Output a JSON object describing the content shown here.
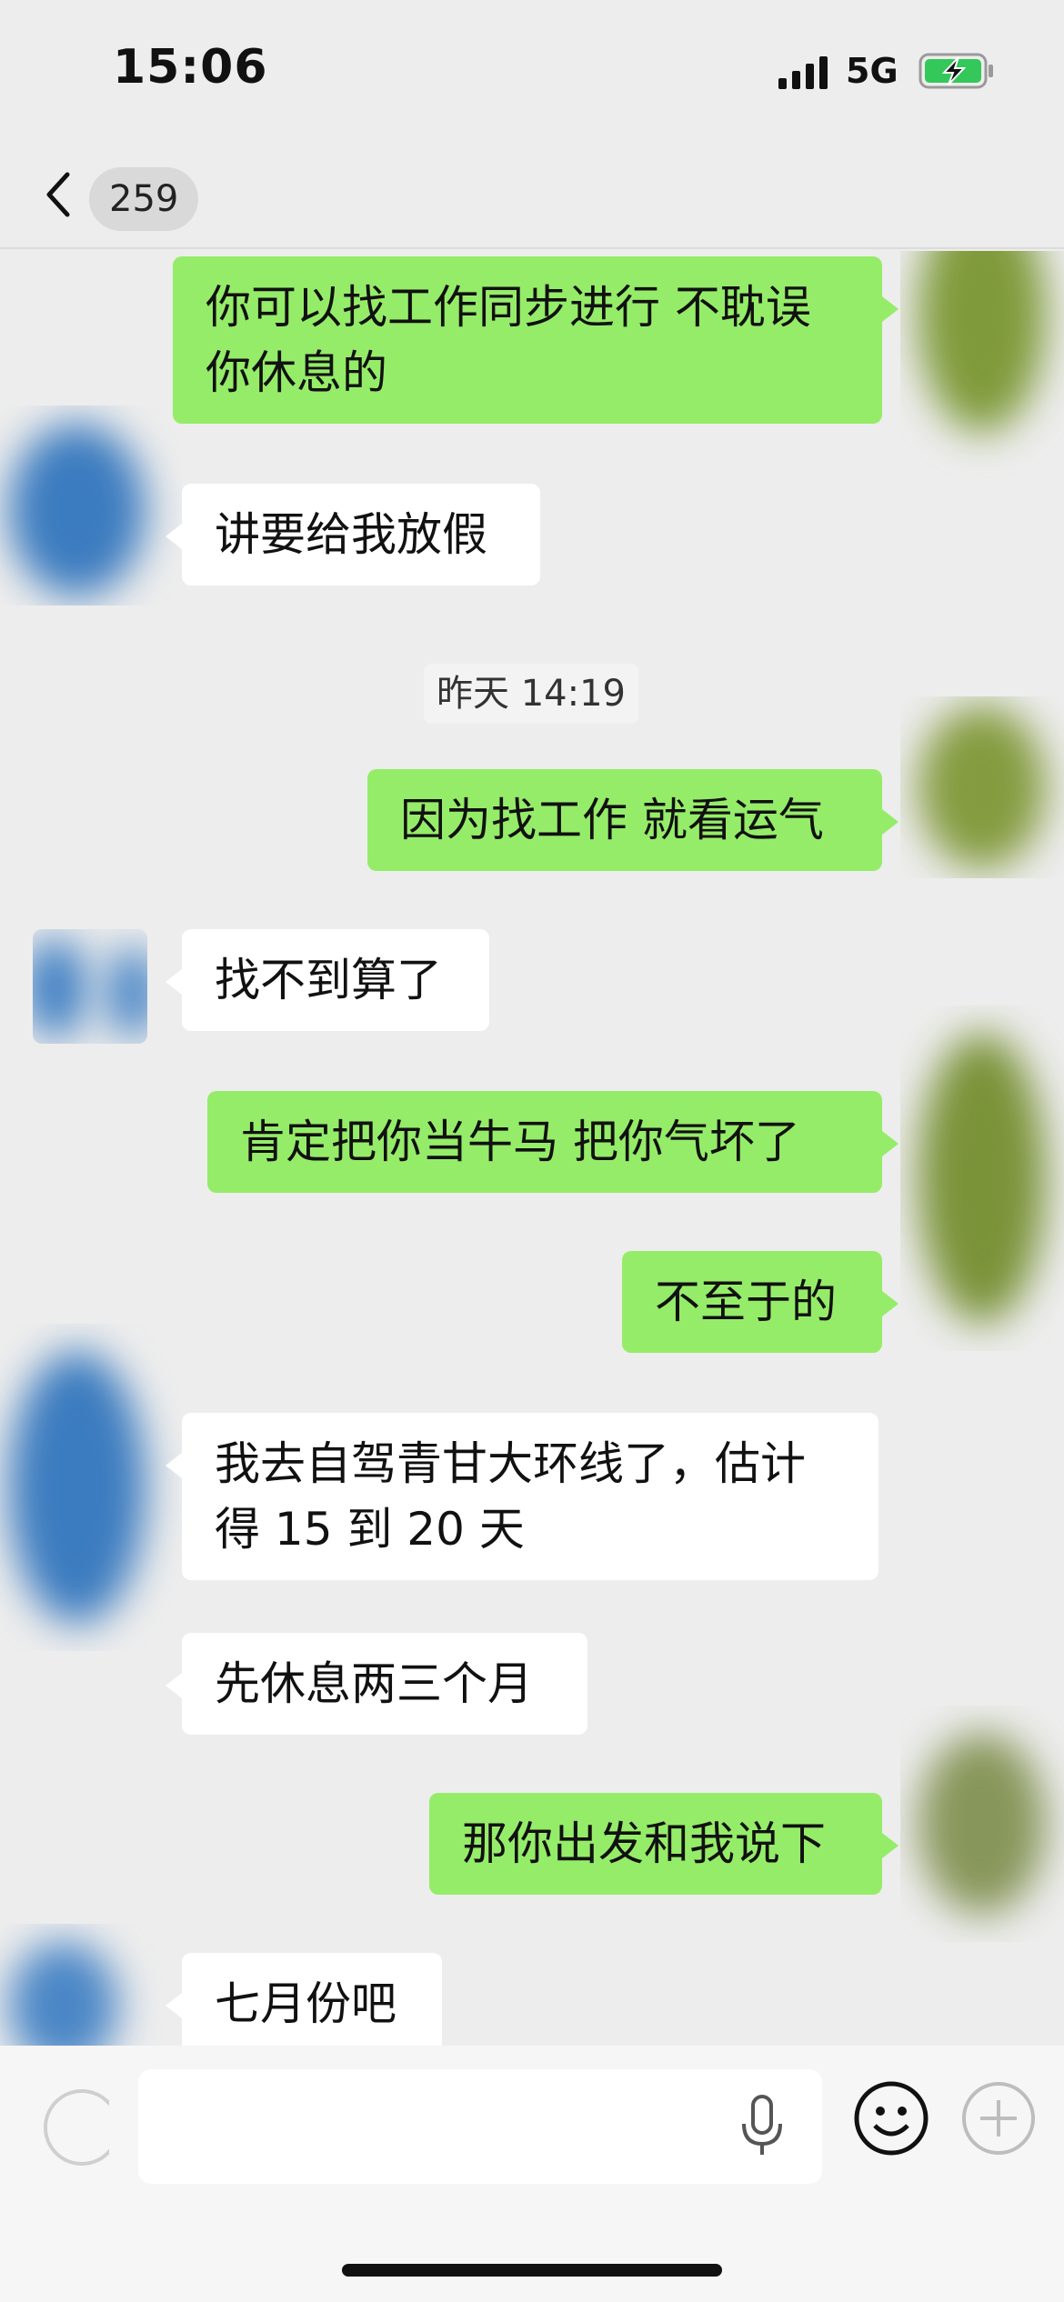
{
  "status_bar": {
    "time": "15:06",
    "network": "5G",
    "signal_icon": "signal-bars-icon",
    "battery_icon": "battery-charging-icon",
    "battery_color": "#34c759"
  },
  "nav": {
    "back_icon": "chevron-left-icon",
    "unread_count": "259"
  },
  "colors": {
    "outgoing_bubble": "#95ec69",
    "incoming_bubble": "#ffffff",
    "chat_background": "#ededed"
  },
  "messages": [
    {
      "direction": "out",
      "text_lines": [
        "你可以找工作同步进行 不耽误",
        "你休息的"
      ]
    },
    {
      "direction": "in",
      "text": "讲要给我放假"
    },
    {
      "type": "timestamp",
      "text": "昨天 14:19"
    },
    {
      "direction": "out",
      "text": "因为找工作 就看运气"
    },
    {
      "direction": "in",
      "text": "找不到算了"
    },
    {
      "direction": "out",
      "text": "肯定把你当牛马  把你气坏了"
    },
    {
      "direction": "out",
      "text": "不至于的"
    },
    {
      "direction": "in",
      "text_lines": [
        "我去自驾青甘大环线了，估计",
        "得 15 到 20 天"
      ]
    },
    {
      "direction": "in",
      "text": "先休息两三个月"
    },
    {
      "direction": "out",
      "text": "那你出发和我说下"
    },
    {
      "direction": "in",
      "text": "七月份吧"
    }
  ],
  "input_bar": {
    "placeholder": "",
    "voice_icon": "microphone-icon",
    "emoji_icon": "emoji-face-icon",
    "plus_icon": "plus-circle-icon"
  }
}
